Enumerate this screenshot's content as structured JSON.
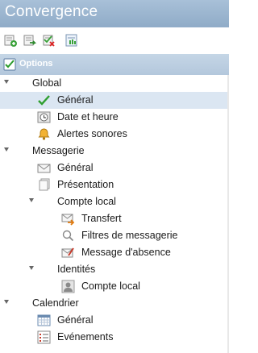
{
  "app": {
    "title": "Convergence"
  },
  "toolbar": {
    "buttons": [
      {
        "icon": "add-item-icon"
      },
      {
        "icon": "move-item-icon"
      },
      {
        "icon": "delete-item-icon"
      },
      {
        "icon": "properties-icon"
      }
    ]
  },
  "options": {
    "label": "Options"
  },
  "tree": {
    "global": {
      "label": "Global",
      "items": [
        {
          "label": "Général",
          "icon": "checkmark-icon",
          "selected": true
        },
        {
          "label": "Date et heure",
          "icon": "clock-icon"
        },
        {
          "label": "Alertes sonores",
          "icon": "bell-icon"
        }
      ]
    },
    "messagerie": {
      "label": "Messagerie",
      "items": [
        {
          "label": "Général",
          "icon": "envelope-icon"
        },
        {
          "label": "Présentation",
          "icon": "document-icon"
        }
      ],
      "compte_local": {
        "label": "Compte local",
        "items": [
          {
            "label": "Transfert",
            "icon": "forward-mail-icon"
          },
          {
            "label": "Filtres de messagerie",
            "icon": "magnifier-icon"
          },
          {
            "label": "Message d'absence",
            "icon": "away-message-icon"
          }
        ]
      },
      "identites": {
        "label": "Identités",
        "items": [
          {
            "label": "Compte local",
            "icon": "user-card-icon"
          }
        ]
      }
    },
    "calendrier": {
      "label": "Calendrier",
      "items": [
        {
          "label": "Général",
          "icon": "calendar-icon"
        },
        {
          "label": "Evénements",
          "icon": "event-list-icon"
        }
      ]
    }
  }
}
